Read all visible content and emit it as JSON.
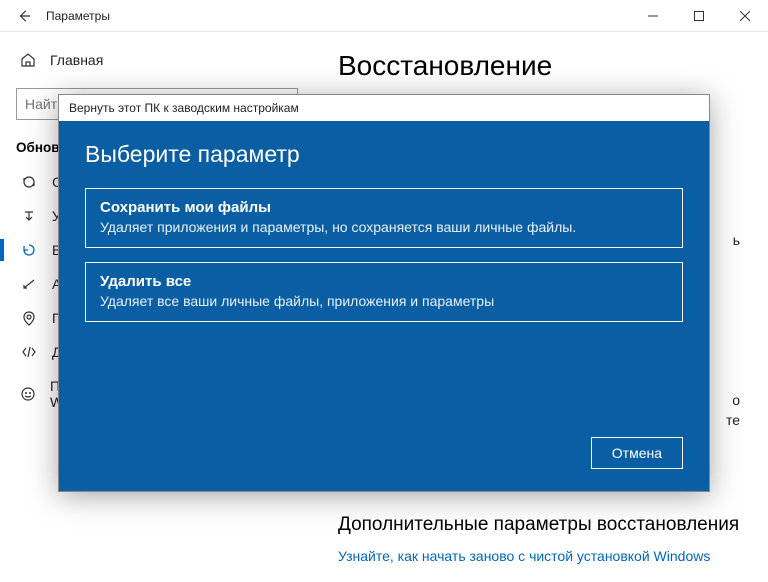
{
  "titlebar": {
    "title": "Параметры"
  },
  "sidebar": {
    "home": "Главная",
    "search_placeholder": "Найт",
    "section": "Обнов",
    "items": [
      {
        "label": "С"
      },
      {
        "label": "У"
      },
      {
        "label": "Во"
      },
      {
        "label": "А"
      },
      {
        "label": "П"
      },
      {
        "label": "Д"
      },
      {
        "label": "Программа предварительной оценки Windows"
      }
    ]
  },
  "content": {
    "page_title": "Восстановление",
    "side_fragment1": "ь",
    "side_fragment2": "о",
    "side_fragment3": "те",
    "subhead": "Дополнительные параметры восстановления",
    "link": "Узнайте, как начать заново с чистой установкой Windows"
  },
  "modal": {
    "title": "Вернуть этот ПК к заводским настройкам",
    "heading": "Выберите параметр",
    "options": [
      {
        "title": "Сохранить мои файлы",
        "desc": "Удаляет приложения и параметры, но сохраняется ваши личные файлы."
      },
      {
        "title": "Удалить все",
        "desc": "Удаляет все ваши личные файлы, приложения и параметры"
      }
    ],
    "cancel": "Отмена"
  }
}
